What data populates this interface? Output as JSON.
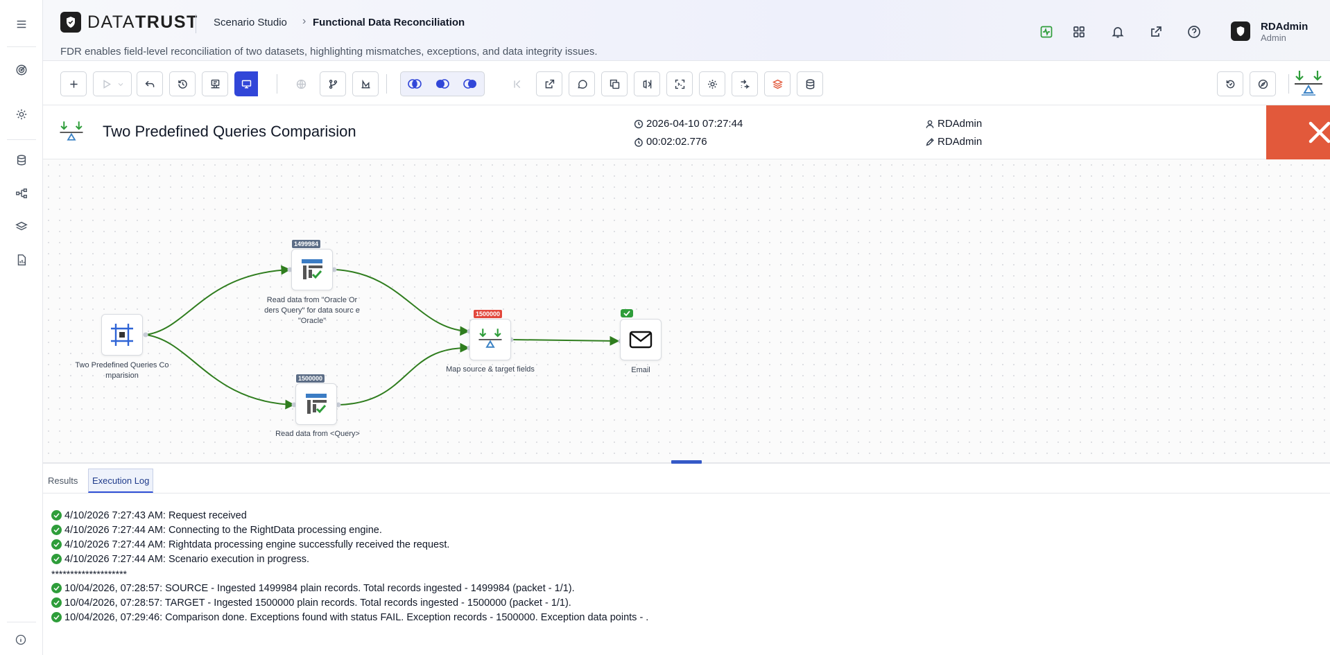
{
  "brand": {
    "bold": "DATA",
    "light": "TRUST"
  },
  "breadcrumb": {
    "parent": "Scenario Studio",
    "current": "Functional Data Reconciliation"
  },
  "header": {
    "subtitle": "FDR enables field-level reconciliation of two datasets, highlighting mismatches, exceptions, and data integrity issues."
  },
  "user": {
    "name": "RDAdmin",
    "role": "Admin"
  },
  "scenario": {
    "title": "Two Predefined Queries Comparision",
    "timestamp": "2026-04-10 07:27:44",
    "duration": "00:02:02.776",
    "created_by": "RDAdmin",
    "modified_by": "RDAdmin"
  },
  "nodes": {
    "start": {
      "label": "Two Predefined Queries Co mparision"
    },
    "source": {
      "label": "Read data from \"Oracle Or ders Query\" for data sourc e \"Oracle\"",
      "count": "1499984"
    },
    "target": {
      "label": "Read data from <Query>",
      "count": "1500000"
    },
    "map": {
      "label": "Map source & target fields",
      "count": "1500000"
    },
    "email": {
      "label": "Email"
    }
  },
  "tabs": [
    {
      "label": "Results"
    },
    {
      "label": "Execution Log"
    }
  ],
  "log": [
    "4/10/2026 7:27:43 AM: Request received",
    "4/10/2026 7:27:44 AM: Connecting to the RightData processing engine.",
    "4/10/2026 7:27:44 AM: Rightdata processing engine successfully received the request.",
    "4/10/2026 7:27:44 AM: Scenario execution in progress.",
    "********************",
    "10/04/2026, 07:28:57: SOURCE - Ingested 1499984 plain records. Total records ingested - 1499984 (packet - 1/1).",
    "10/04/2026, 07:28:57: TARGET - Ingested 1500000 plain records. Total records ingested - 1500000 (packet - 1/1).",
    "10/04/2026, 07:29:46: Comparison done. Exceptions found with status FAIL. Exception records - 1500000. Exception data points - ."
  ],
  "colors": {
    "accent": "#3146d8",
    "close": "#e2593b",
    "success": "#2e9d3a",
    "edge": "#2f7d1e",
    "badge_red": "#e2483d"
  }
}
